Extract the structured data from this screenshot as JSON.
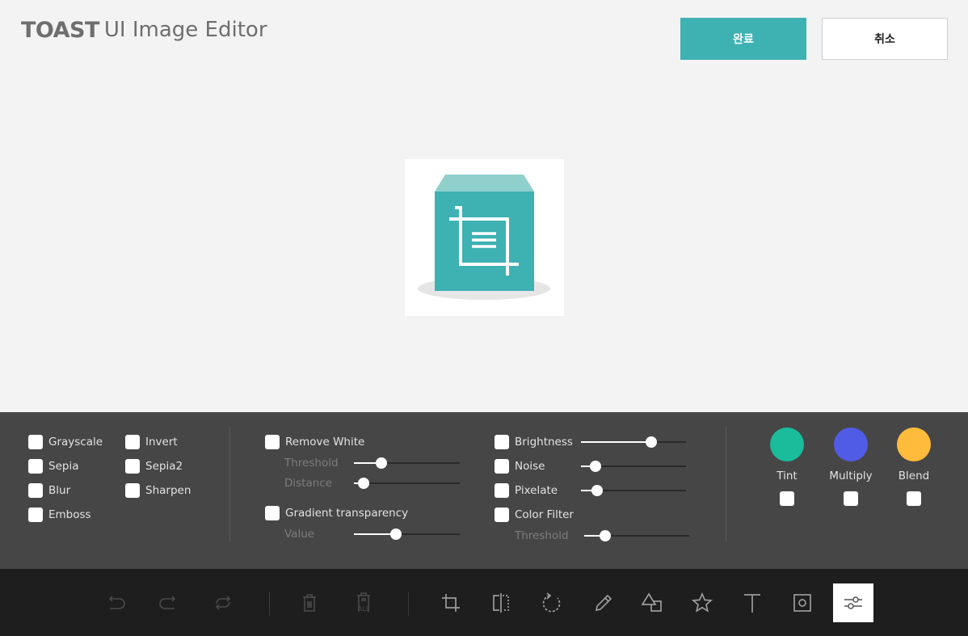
{
  "header": {
    "brand": "TOAST",
    "product": "UI Image Editor",
    "done_label": "완료",
    "cancel_label": "취소"
  },
  "filters": {
    "col1": [
      "Grayscale",
      "Sepia",
      "Blur",
      "Emboss"
    ],
    "col2": [
      "Invert",
      "Sepia2",
      "Sharpen"
    ],
    "remove_white": "Remove White",
    "threshold_label": "Threshold",
    "distance_label": "Distance",
    "gradient": "Gradient transparency",
    "value_label": "Value",
    "brightness": "Brightness",
    "noise": "Noise",
    "pixelate": "Pixelate",
    "color_filter": "Color Filter",
    "color_threshold_label": "Threshold",
    "tint": "Tint",
    "multiply": "Multiply",
    "blend": "Blend"
  },
  "slider_levels": {
    "remove_white_threshold": 0.26,
    "remove_white_distance": 0.09,
    "gradient_value": 0.4,
    "brightness": 0.67,
    "noise": 0.14,
    "pixelate": 0.15,
    "color_filter_threshold": 0.2
  },
  "colors": {
    "accent": "#3eb1b3",
    "tint": "#1abc9c",
    "multiply": "#515ce6",
    "blend": "#ffbb3b"
  },
  "toolbar_icons": [
    "undo-icon",
    "redo-icon",
    "reset-icon",
    "delete-icon",
    "delete-all-icon",
    "crop-icon",
    "flip-icon",
    "rotate-icon",
    "draw-icon",
    "shape-icon",
    "icon-icon",
    "text-icon",
    "mask-icon",
    "filter-icon"
  ],
  "delete_all_text": "ALL"
}
